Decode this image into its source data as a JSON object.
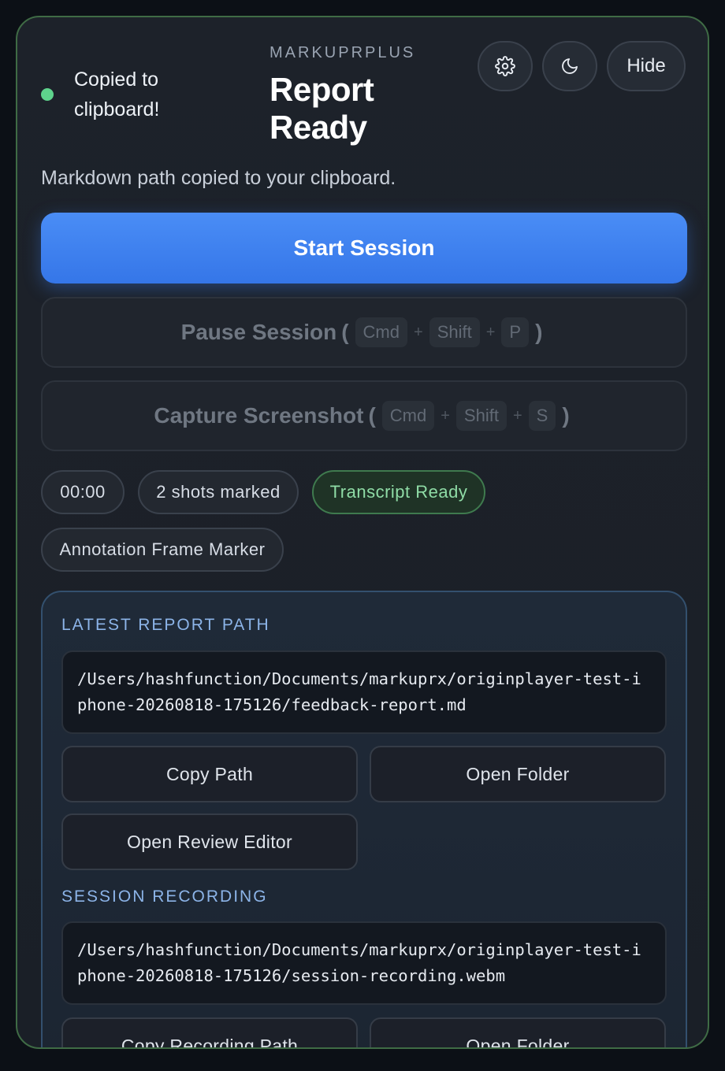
{
  "status": {
    "text": "Copied to clipboard!",
    "color": "#5ed38c"
  },
  "header": {
    "brand": "MARKUPRPLUS",
    "title": "Report Ready",
    "settings_icon": "gear-icon",
    "theme_icon": "moon-icon",
    "hide_label": "Hide"
  },
  "subtitle": "Markdown path copied to your clipboard.",
  "actions": {
    "start_label": "Start Session",
    "pause_label": "Pause Session",
    "pause_keys": [
      "Cmd",
      "Shift",
      "P"
    ],
    "capture_label": "Capture Screenshot",
    "capture_keys": [
      "Cmd",
      "Shift",
      "S"
    ],
    "shortcut_open": "(",
    "shortcut_close": ")",
    "plus": "+"
  },
  "chips": {
    "timer": "00:00",
    "shots": "2 shots marked",
    "transcript": "Transcript Ready",
    "annotation": "Annotation Frame Marker"
  },
  "report": {
    "label": "LATEST REPORT PATH",
    "path": "/Users/hashfunction/Documents/markuprx/originplayer-test-iphone-20260818-175126/feedback-report.md",
    "copy_label": "Copy Path",
    "open_folder_label": "Open Folder",
    "review_label": "Open Review Editor"
  },
  "recording": {
    "label": "SESSION RECORDING",
    "path": "/Users/hashfunction/Documents/markuprx/originplayer-test-iphone-20260818-175126/session-recording.webm",
    "copy_label": "Copy Recording Path",
    "open_folder_label": "Open Folder"
  },
  "colors": {
    "accent": "#3b82f6",
    "panel_border": "#3f6b45",
    "card_border": "#33506e",
    "section_label": "#8cb4e8"
  }
}
